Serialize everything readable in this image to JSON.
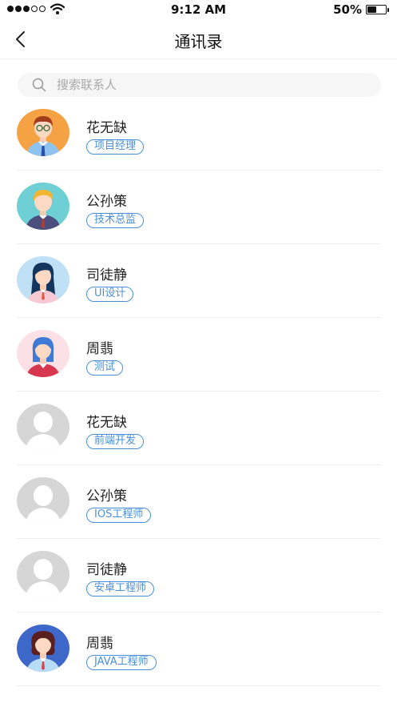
{
  "status_bar": {
    "time": "9:12 AM",
    "battery_percent": "50%",
    "battery_level": 0.5,
    "signal_bars_filled": 3,
    "signal_bars_total": 5,
    "wifi_icon": "wifi-icon"
  },
  "nav": {
    "title": "通讯录",
    "back_icon": "chevron-left-icon"
  },
  "search": {
    "placeholder": "搜索联系人",
    "value": "",
    "icon": "search-icon"
  },
  "contacts": [
    {
      "name": "花无缺",
      "role": "项目经理",
      "avatar": "man-glasses-avatar"
    },
    {
      "name": "公孙策",
      "role": "技术总监",
      "avatar": "man-blond-avatar"
    },
    {
      "name": "司徒静",
      "role": "UI设计",
      "avatar": "woman-dark-hair-avatar"
    },
    {
      "name": "周翡",
      "role": "测试",
      "avatar": "woman-blue-hair-avatar"
    },
    {
      "name": "花无缺",
      "role": "前端开发",
      "avatar": "default-avatar"
    },
    {
      "name": "公孙策",
      "role": "IOS工程师",
      "avatar": "default-avatar"
    },
    {
      "name": "司徒静",
      "role": "安卓工程师",
      "avatar": "default-avatar"
    },
    {
      "name": "周翡",
      "role": "JAVA工程师",
      "avatar": "woman-curly-hair-avatar"
    }
  ],
  "colors": {
    "accent": "#4a90d9",
    "divider": "#ececec",
    "search_bg": "#f6f6f6",
    "avatar_bg": [
      "#f4a244",
      "#6ecfd4",
      "#bfe0f5",
      "#fbe0e6",
      "#d6d6d6",
      "#d6d6d6",
      "#d6d6d6",
      "#3d67c8"
    ]
  }
}
